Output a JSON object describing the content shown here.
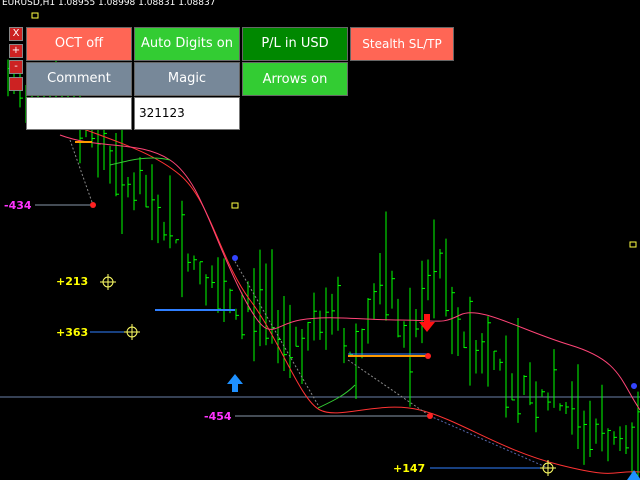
{
  "header": {
    "symbol_title": "EURUSD,H1  1.08955 1.08998 1.08831 1.08837",
    "close_label": "X",
    "plus_label": "+",
    "minus_label": "-"
  },
  "panel": {
    "oct_label": "OCT off",
    "auto_digits_label": "Auto Digits on",
    "pl_label": "P/L in USD",
    "stealth_label": "Stealth SL/TP",
    "comment_label": "Comment",
    "magic_label": "Magic",
    "arrows_label": "Arrows on",
    "comment_value": "",
    "magic_value": "321123"
  },
  "trade_labels": [
    {
      "text": "-434",
      "color": "#ff33ff"
    },
    {
      "text": "+213",
      "color": "#ffff00"
    },
    {
      "text": "+363",
      "color": "#ffff00"
    },
    {
      "text": "-454",
      "color": "#ff33ff"
    },
    {
      "text": "+147",
      "color": "#ffff00"
    }
  ],
  "colors": {
    "background": "#000000",
    "candles": "#00ff00",
    "ma_red": "#ff3333",
    "ma_pink": "#ff4477",
    "oct_button": "#ff6655",
    "green_button": "#33cc33",
    "dark_green_button": "#008800",
    "grey_button": "#778899",
    "buy_arrow": "#1e90ff",
    "sell_arrow": "#ff0000"
  }
}
